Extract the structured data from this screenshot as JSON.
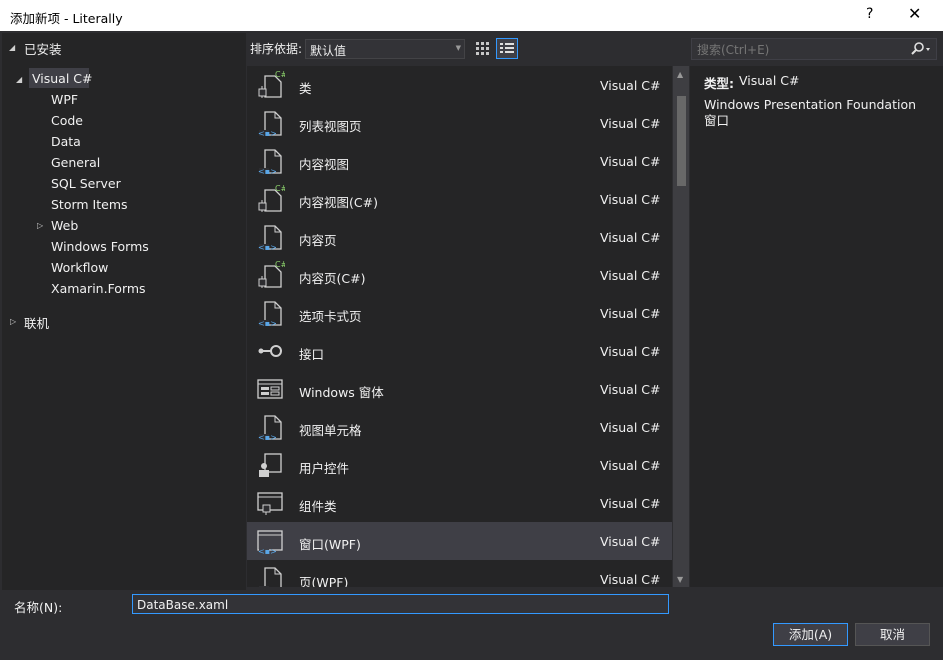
{
  "window": {
    "title": "添加新项 - Literally",
    "help": "?",
    "close": "✕"
  },
  "tree": {
    "installed": "已安装",
    "visual_csharp": "Visual C#",
    "children": [
      "WPF",
      "Code",
      "Data",
      "General",
      "SQL Server",
      "Storm Items",
      "Web",
      "Windows Forms",
      "Workflow",
      "Xamarin.Forms"
    ],
    "online": "联机"
  },
  "sort": {
    "label": "排序依据:",
    "value": "默认值"
  },
  "search": {
    "placeholder": "搜索(Ctrl+E)"
  },
  "templates": [
    {
      "name": "类",
      "lang": "Visual C#",
      "icon": "class-icon"
    },
    {
      "name": "列表视图页",
      "lang": "Visual C#",
      "icon": "page-icon"
    },
    {
      "name": "内容视图",
      "lang": "Visual C#",
      "icon": "page-icon"
    },
    {
      "name": "内容视图(C#)",
      "lang": "Visual C#",
      "icon": "class-icon"
    },
    {
      "name": "内容页",
      "lang": "Visual C#",
      "icon": "page-icon"
    },
    {
      "name": "内容页(C#)",
      "lang": "Visual C#",
      "icon": "class-icon"
    },
    {
      "name": "选项卡式页",
      "lang": "Visual C#",
      "icon": "page-icon"
    },
    {
      "name": "接口",
      "lang": "Visual C#",
      "icon": "interface-icon"
    },
    {
      "name": "Windows 窗体",
      "lang": "Visual C#",
      "icon": "form-icon"
    },
    {
      "name": "视图单元格",
      "lang": "Visual C#",
      "icon": "page-icon"
    },
    {
      "name": "用户控件",
      "lang": "Visual C#",
      "icon": "user-control-icon"
    },
    {
      "name": "组件类",
      "lang": "Visual C#",
      "icon": "component-icon"
    },
    {
      "name": "窗口(WPF)",
      "lang": "Visual C#",
      "icon": "window-icon",
      "selected": true
    },
    {
      "name": "页(WPF)",
      "lang": "Visual C#",
      "icon": "page-icon"
    }
  ],
  "detail": {
    "type_label": "类型:",
    "type_value": "Visual C#",
    "description": "Windows Presentation Foundation 窗口"
  },
  "name_field": {
    "label": "名称(N):",
    "value": "DataBase.xaml"
  },
  "buttons": {
    "add": "添加(A)",
    "cancel": "取消"
  },
  "colors": {
    "accent": "#3399ff",
    "background": "#2d2d30",
    "panel": "#252526",
    "selection": "#3f3f46"
  }
}
